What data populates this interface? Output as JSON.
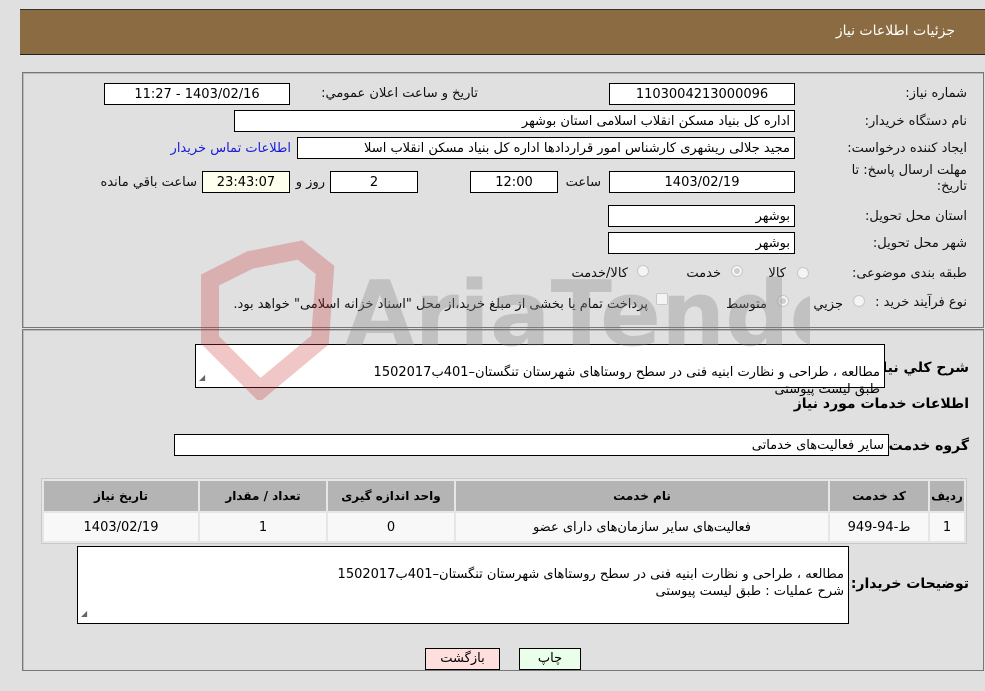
{
  "header": {
    "title": "جزئیات اطلاعات نیاز"
  },
  "details": {
    "need_number_label": "شماره نیاز:",
    "need_number": "1103004213000096",
    "announce_label": "تاریخ و ساعت اعلان عمومي:",
    "announce_value": "1403/02/16 - 11:27",
    "buyer_org_label": "نام دستگاه خریدار:",
    "buyer_org": "اداره کل بنیاد مسکن انقلاب اسلامی استان بوشهر",
    "creator_label": "ایجاد کننده درخواست:",
    "creator": "مجید جلالی ریشهری کارشناس امور قراردادها اداره کل بنیاد مسکن انقلاب اسلا",
    "contact_link": "اطلاعات تماس خریدار",
    "deadline_label_line1": "مهلت ارسال پاسخ: تا",
    "deadline_label_line2": "تاریخ:",
    "deadline_date": "1403/02/19",
    "time_label": "ساعت",
    "deadline_time": "12:00",
    "days_value": "2",
    "days_label": "روز و",
    "remaining_time": "23:43:07",
    "remaining_label": "ساعت باقي مانده",
    "province_label": "استان محل تحویل:",
    "province": "بوشهر",
    "city_label": "شهر محل تحویل:",
    "city": "بوشهر",
    "category_label": "طبقه بندی موضوعی:",
    "category_options": [
      "کالا",
      "خدمت",
      "کالا/خدمت"
    ],
    "category_selected": "خدمت",
    "process_label": "نوع فرآیند خرید :",
    "process_options": [
      "جزيي",
      "متوسط"
    ],
    "process_selected": "متوسط",
    "treasury_note": "پرداخت تمام یا بخشی از مبلغ خرید،از محل \"اسناد خزانه اسلامی\" خواهد بود."
  },
  "summary": {
    "label": "شرح کلي نیاز:",
    "text": "مطالعه ، طراحی و نظارت ابنیه فنی در سطح روستاهای شهرستان تنگستان–401ب1502017\n طبق لیست پیوستی"
  },
  "services": {
    "section_title": "اطلاعات خدمات مورد نیاز",
    "group_label": "گروه خدمت:",
    "group_value": "سایر فعالیت‌های خدماتی",
    "columns": [
      "ردیف",
      "کد خدمت",
      "نام خدمت",
      "واحد اندازه گیری",
      "تعداد / مقدار",
      "تاریخ نیاز"
    ],
    "rows": [
      {
        "row": "1",
        "code": "ط-94-949",
        "name": "فعالیت‌های سایر سازمان‌های دارای عضو",
        "unit": "0",
        "qty": "1",
        "date": "1403/02/19"
      }
    ]
  },
  "buyer_notes": {
    "label": "توضیحات خریدار:",
    "text": "مطالعه ، طراحی و نظارت ابنیه فنی در سطح روستاهای شهرستان تنگستان–401ب1502017\nشرح عملیات : طبق لیست پیوستی"
  },
  "buttons": {
    "print": "چاپ",
    "back": "بازگشت"
  },
  "colors": {
    "header_bg": "#8b6b42",
    "print_bg": "#eaffea",
    "back_bg": "#ffdede",
    "link": "#1a1adb"
  },
  "watermark": {
    "text": "AriaTender.neT"
  }
}
